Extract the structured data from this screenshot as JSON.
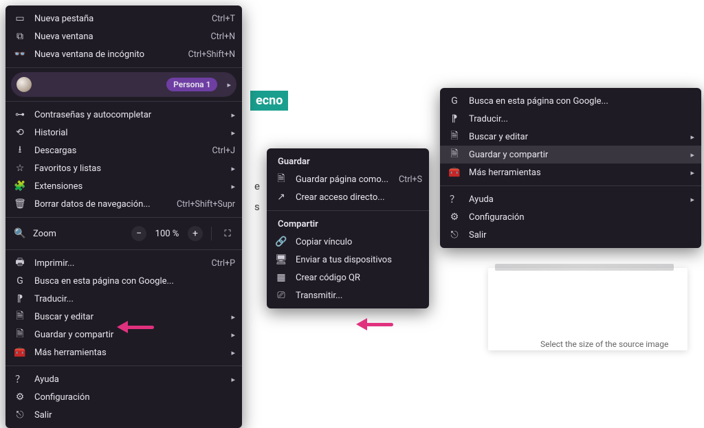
{
  "ecno": "ecno",
  "main_menu": {
    "new_tab": "Nueva pestaña",
    "new_tab_sc": "Ctrl+T",
    "new_window": "Nueva ventana",
    "new_window_sc": "Ctrl+N",
    "incognito": "Nueva ventana de incógnito",
    "incognito_sc": "Ctrl+Shift+N",
    "persona": "Persona 1",
    "passwords": "Contraseñas y autocompletar",
    "history": "Historial",
    "downloads": "Descargas",
    "downloads_sc": "Ctrl+J",
    "bookmarks": "Favoritos y listas",
    "extensions": "Extensiones",
    "clear_data": "Borrar datos de navegación...",
    "clear_data_sc": "Ctrl+Shift+Supr",
    "zoom": "Zoom",
    "zoom_pct": "100 %",
    "print": "Imprimir...",
    "print_sc": "Ctrl+P",
    "find_google": "Busca en esta página con Google...",
    "translate": "Traducir...",
    "find_edit": "Buscar y editar",
    "save_share": "Guardar y compartir",
    "more_tools": "Más herramientas",
    "help": "Ayuda",
    "settings": "Configuración",
    "exit": "Salir"
  },
  "submenu": {
    "section_save": "Guardar",
    "save_page_as": "Guardar página como...",
    "save_page_as_sc": "Ctrl+S",
    "create_shortcut": "Crear acceso directo...",
    "section_share": "Compartir",
    "copy_link": "Copiar vínculo",
    "send_devices": "Enviar a tus dispositivos",
    "create_qr": "Crear código QR",
    "cast": "Transmitir..."
  },
  "third": {
    "find_google": "Busca en esta página con Google...",
    "translate": "Traducir...",
    "find_edit": "Buscar y editar",
    "save_share": "Guardar y compartir",
    "more_tools": "Más herramientas",
    "help": "Ayuda",
    "settings": "Configuración",
    "exit": "Salir"
  },
  "cutoff": "Select the size of the source image"
}
